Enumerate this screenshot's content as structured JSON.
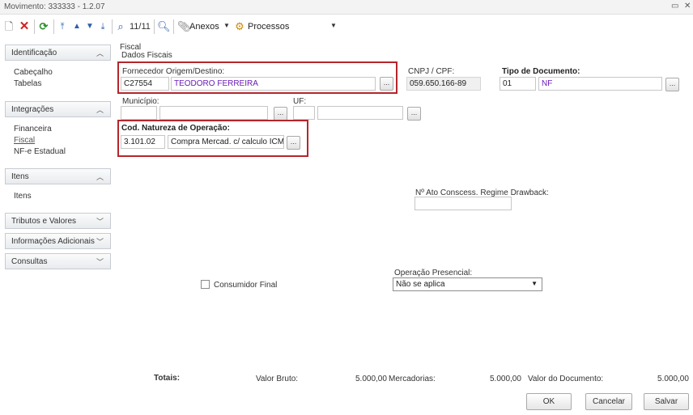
{
  "window": {
    "title": "Movimento: 333333 - 1.2.07",
    "controls": [
      "restore-icon",
      "close-icon"
    ]
  },
  "toolbar": {
    "record_counter": "11/11",
    "anexos_label": "Anexos",
    "processos_label": "Processos"
  },
  "sidebar": {
    "sections": [
      {
        "label": "Identificação",
        "expanded": true,
        "items": [
          "Cabeçalho",
          "Tabelas"
        ]
      },
      {
        "label": "Integrações",
        "expanded": true,
        "items": [
          "Financeira",
          "Fiscal",
          "NF-e Estadual"
        ]
      },
      {
        "label": "Itens",
        "expanded": true,
        "items": [
          "Itens"
        ]
      },
      {
        "label": "Tributos e Valores",
        "expanded": false,
        "items": []
      },
      {
        "label": "Informações Adicionais",
        "expanded": false,
        "items": []
      },
      {
        "label": "Consultas",
        "expanded": false,
        "items": []
      }
    ]
  },
  "content": {
    "breadcrumb": "Fiscal",
    "group_title": "Dados Fiscais",
    "fornecedor": {
      "label": "Fornecedor Origem/Destino:",
      "code": "C27554",
      "name": "TEODORO FERREIRA"
    },
    "cnpj": {
      "label": "CNPJ / CPF:",
      "value": "059.650.166-89"
    },
    "tipo_documento": {
      "label": "Tipo de Documento:",
      "code": "01",
      "name": "NF"
    },
    "municipio": {
      "label": "Município:",
      "code": "",
      "name": ""
    },
    "uf": {
      "label": "UF:",
      "code": "",
      "name": ""
    },
    "natureza": {
      "label": "Cod. Natureza de Operação:",
      "code": "3.101.02",
      "description": "Compra Mercad. c/ calculo ICMS"
    },
    "drawback": {
      "label": "Nº Ato Conscess. Regime Drawback:",
      "value": ""
    },
    "consumidor_final": {
      "label": "Consumidor Final",
      "checked": false
    },
    "operacao_presencial": {
      "label": "Operação Presencial:",
      "value": "Não se aplica"
    },
    "ellipsis": "..."
  },
  "totals": {
    "label": "Totais:",
    "valor_bruto_label": "Valor Bruto:",
    "valor_bruto": "5.000,00",
    "mercadorias_label": "Mercadorias:",
    "mercadorias": "5.000,00",
    "valor_documento_label": "Valor do Documento:",
    "valor_documento": "5.000,00"
  },
  "buttons": {
    "ok": "OK",
    "cancelar": "Cancelar",
    "salvar": "Salvar"
  },
  "colors": {
    "highlight_border": "#b5262c",
    "link_purple": "#6a1bb7"
  }
}
